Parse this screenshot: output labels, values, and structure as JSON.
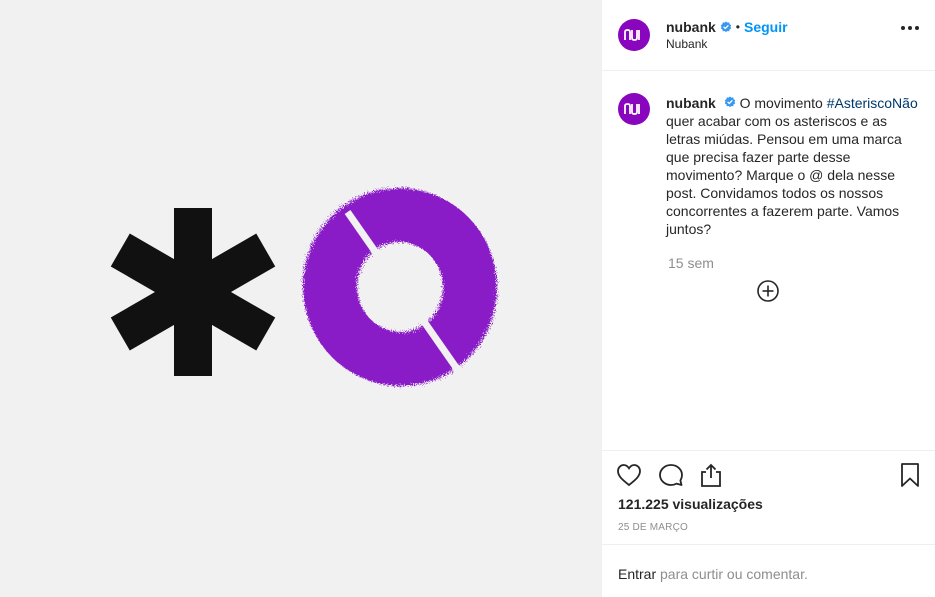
{
  "post": {
    "username": "nubank",
    "follow_label": "Seguir",
    "separator": "•",
    "location": "Nubank",
    "caption_username": "nubank",
    "caption_intro": "O movimento",
    "hashtag": "#AsteriscoNão",
    "caption_body": "quer acabar com os asteriscos e as letras miúdas. Pensou em uma marca que precisa fazer parte desse movimento? Marque o @ dela nesse post. Convidamos todos os nossos concorrentes a fazerem parte. Vamos juntos?",
    "time_ago": "15 sem",
    "views": "121.225 visualizações",
    "date": "25 DE MARÇO"
  },
  "footer": {
    "login_label": "Entrar",
    "login_suffix": " para curtir ou comentar."
  },
  "icons": {
    "verified": "verified-badge-icon",
    "more": "more-options-icon",
    "like": "heart-icon",
    "comment": "comment-icon",
    "share": "share-icon",
    "save": "bookmark-icon",
    "load_more": "plus-circle-icon"
  },
  "colors": {
    "brand_purple": "#8a05be",
    "link_blue": "#0095f6",
    "hashtag_blue": "#00376b",
    "muted_text": "#8e8e8e",
    "media_background": "#f1f1f1"
  }
}
